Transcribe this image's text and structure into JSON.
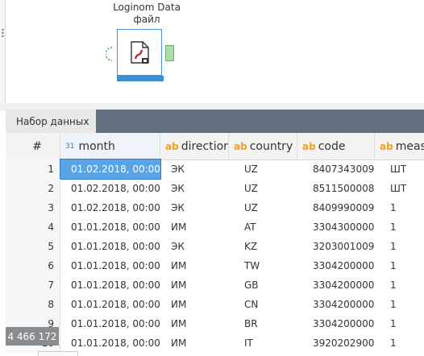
{
  "node": {
    "title_line1": "Loginom Data",
    "title_line2": "файл",
    "icon": "file-icon"
  },
  "panel": {
    "tab_label": "Набор данных"
  },
  "table": {
    "row_header": "#",
    "columns": [
      {
        "label": "month",
        "type_icon": "31"
      },
      {
        "label": "direction",
        "type_icon": "ab"
      },
      {
        "label": "country",
        "type_icon": "ab"
      },
      {
        "label": "code",
        "type_icon": "ab"
      },
      {
        "label": "meas",
        "type_icon": "ab"
      }
    ],
    "rows": [
      {
        "n": "1",
        "month": "01.02.2018, 00:00",
        "direction": "ЭК",
        "country": "UZ",
        "code": "8407343009",
        "meas": "ШТ"
      },
      {
        "n": "2",
        "month": "01.02.2018, 00:00",
        "direction": "ЭК",
        "country": "UZ",
        "code": "8511500008",
        "meas": "ШТ"
      },
      {
        "n": "3",
        "month": "01.02.2018, 00:00",
        "direction": "ЭК",
        "country": "UZ",
        "code": "8409990009",
        "meas": "1"
      },
      {
        "n": "4",
        "month": "01.01.2018, 00:00",
        "direction": "ИМ",
        "country": "AT",
        "code": "3304300000",
        "meas": "1"
      },
      {
        "n": "5",
        "month": "01.01.2018, 00:00",
        "direction": "ЭК",
        "country": "KZ",
        "code": "3203001009",
        "meas": "1"
      },
      {
        "n": "6",
        "month": "01.01.2018, 00:00",
        "direction": "ИМ",
        "country": "TW",
        "code": "3304200000",
        "meas": "1"
      },
      {
        "n": "7",
        "month": "01.01.2018, 00:00",
        "direction": "ИМ",
        "country": "GB",
        "code": "3304200000",
        "meas": "1"
      },
      {
        "n": "8",
        "month": "01.01.2018, 00:00",
        "direction": "ИМ",
        "country": "CN",
        "code": "3304200000",
        "meas": "1"
      },
      {
        "n": "9",
        "month": "01.01.2018, 00:00",
        "direction": "ИМ",
        "country": "BR",
        "code": "3304200000",
        "meas": "1"
      },
      {
        "n": "10",
        "month": "01.01.2018, 00:00",
        "direction": "ИМ",
        "country": "IT",
        "code": "3920202900",
        "meas": "1"
      }
    ],
    "total_rows": "4 466 172"
  },
  "colors": {
    "accent": "#3b8ed8",
    "tabbar": "#62707d",
    "selected": "#5aa4e6",
    "type_ab": "#f0a020"
  }
}
